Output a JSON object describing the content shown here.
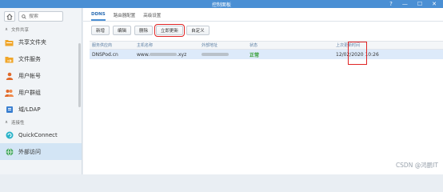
{
  "window": {
    "title": "控制面板",
    "controls": [
      "?",
      "—",
      "☐",
      "✕"
    ]
  },
  "sidebar": {
    "search_placeholder": "搜索",
    "sections": [
      {
        "label": "文件共享"
      },
      {
        "label": "连接性"
      }
    ],
    "items": [
      {
        "label": "共享文件夹",
        "icon": "folder-icon",
        "color": "#f0a62a"
      },
      {
        "label": "文件服务",
        "icon": "file-services-icon",
        "color": "#f0a62a"
      },
      {
        "label": "用户帐号",
        "icon": "user-icon",
        "color": "#e06a2c"
      },
      {
        "label": "用户群组",
        "icon": "group-icon",
        "color": "#e06a2c"
      },
      {
        "label": "域/LDAP",
        "icon": "domain-icon",
        "color": "#3a7fd0"
      },
      {
        "label": "QuickConnect",
        "icon": "quickconnect-icon",
        "color": "#2bb3c9"
      },
      {
        "label": "外部访问",
        "icon": "external-access-icon",
        "color": "#3fa55a"
      }
    ]
  },
  "tabs": [
    {
      "label": "DDNS",
      "active": true
    },
    {
      "label": "路由器配置",
      "active": false
    },
    {
      "label": "高级设置",
      "active": false
    }
  ],
  "toolbar": {
    "add": "新增",
    "edit": "编辑",
    "delete": "删除",
    "update_now": "立即更新",
    "custom": "自定义"
  },
  "table": {
    "headers": [
      "服务供应商",
      "主机名称",
      "外部地址",
      "状态",
      "上次更新时间"
    ],
    "rows": [
      {
        "provider": "DNSPod.cn",
        "hostname": "www.",
        "hostname_suffix": ".xyz",
        "status": "正常",
        "last_update": "12/02/2020 10:26"
      }
    ]
  },
  "watermark": "CSDN @鸿鹏IT",
  "colors": {
    "accent": "#4a8fd4",
    "highlight": "#e02424",
    "status_ok": "#2e9c2e"
  }
}
